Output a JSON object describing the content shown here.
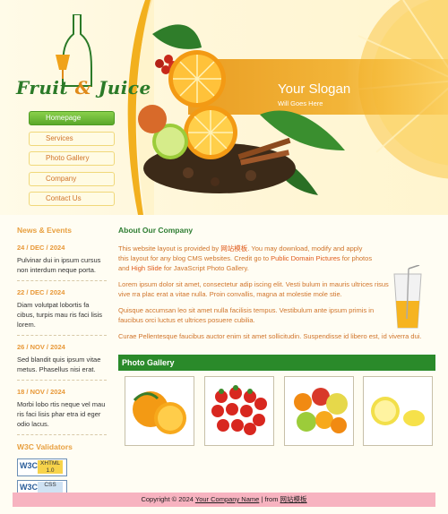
{
  "brand": {
    "name_part1": "Fruit",
    "name_amp": "&",
    "name_part2": "Juice"
  },
  "nav": {
    "items": [
      {
        "label": "Homepage",
        "active": true
      },
      {
        "label": "Services",
        "active": false
      },
      {
        "label": "Photo Gallery",
        "active": false
      },
      {
        "label": "Company",
        "active": false
      },
      {
        "label": "Contact Us",
        "active": false
      }
    ]
  },
  "header": {
    "slogan": "Your Slogan",
    "slogan_sub": "Will Goes Here"
  },
  "news": {
    "title": "News & Events",
    "items": [
      {
        "date": "24 / DEC / 2024",
        "text": "Pulvinar dui in ipsum cursus non interdum neque porta."
      },
      {
        "date": "22 / DEC / 2024",
        "text": "Diam volutpat lobortis fa cibus, turpis mau ris faci lisis lorem."
      },
      {
        "date": "26 / NOV / 2024",
        "text": "Sed blandit quis ipsum vitae metus. Phasellus nisi erat."
      },
      {
        "date": "18 / NOV / 2024",
        "text": "Morbi lobo rtis neque vel mau ris faci lisis phar etra id eger odio lacus."
      }
    ]
  },
  "validators": {
    "title": "W3C Validators",
    "badges": [
      {
        "w3c": "W3C",
        "kind_line1": "XHTML",
        "kind_line2": "1.0"
      },
      {
        "w3c": "W3C",
        "kind_line1": "CSS",
        "kind_line2": ""
      }
    ]
  },
  "about": {
    "title": "About Our Company",
    "p1_a": "This website layout is provided by ",
    "p1_link1": "网站模板",
    "p1_b": ". You may download, modify and apply this layout for any blog CMS websites. Credit go to ",
    "p1_link2": "Public Domain Pictures",
    "p1_c": " for photos and ",
    "p1_link3": "High Slide",
    "p1_d": " for JavaScript Photo Gallery.",
    "p2": "Lorem ipsum dolor sit amet, consectetur adip iscing elit. Vesti bulum in mauris ultrices risus vive rra plac erat a vitae nulla. Proin convallis, magna at molestie mole stie.",
    "p3": "Quisque accumsan leo sit amet nulla facilisis tempus. Vestibulum ante ipsum primis in faucibus orci luctus et ultrices posuere cubilia.",
    "p4": "Curae Pellentesque faucibus auctor enim sit amet sollicitudin. Suspendisse id libero est, id viverra dui."
  },
  "gallery": {
    "title": "Photo Gallery",
    "thumbs": [
      "oranges-photo",
      "strawberries-photo",
      "mixed-fruit-photo",
      "lemons-photo"
    ]
  },
  "footer": {
    "copyright": "Copyright © 2024 ",
    "company": "Your Company Name",
    "from": " | from ",
    "site": "网站模板"
  },
  "colors": {
    "accent_green": "#2a8a2a",
    "accent_orange": "#e8a040",
    "footer_pink": "#f7b3c0"
  }
}
